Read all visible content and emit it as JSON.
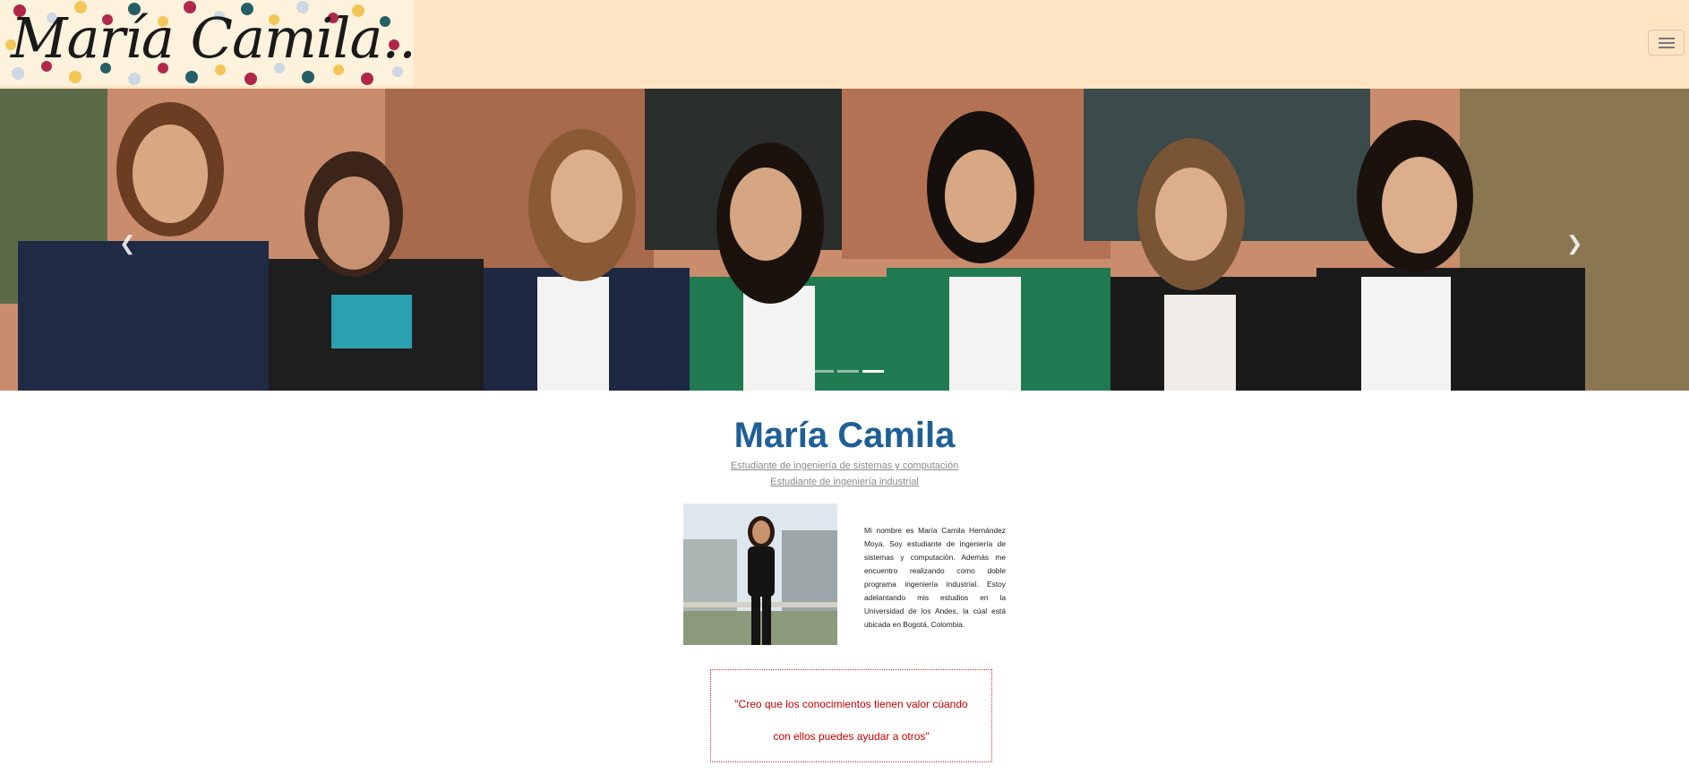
{
  "navbar": {
    "logo_text": "María Camila...",
    "toggle_icon": "hamburger-menu-icon"
  },
  "carousel": {
    "prev_icon": "chevron-left-icon",
    "next_icon": "chevron-right-icon",
    "prev_glyph": "❮",
    "next_glyph": "❯",
    "slide_count": 3,
    "active_slide": 3
  },
  "profile": {
    "name": "María Camila",
    "subtitle_1": "Estudiante de ingeniería de sistemas y computación",
    "subtitle_2": "Estudiante de ingeniería industrial",
    "bio": "Mi nombre es María Camila Hernández Moya. Soy estudiante de ingeniería de sistemas y computación. Además me encuentro realizando como doble programa ingeniería industrial. Estoy adelantando mis estudios en la Universidad de los Andes, la cúal está ubicada en Bogotá, Colombia."
  },
  "quote": {
    "line_1": "\"Creo que los conocimientos tienen valor cúando",
    "line_2": "con ellos puedes ayudar a otros\""
  },
  "colors": {
    "navbar_bg": "#ffe4c4",
    "name_color": "#1f5f95",
    "quote_color": "#c00000"
  }
}
